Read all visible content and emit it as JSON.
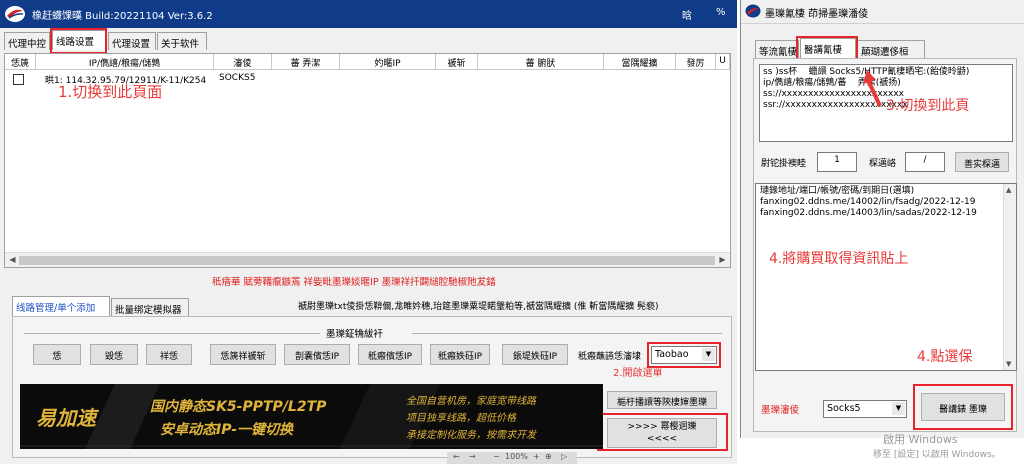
{
  "main": {
    "title": "橡赶蠛馃暵 Build:20221104 Ver:3.6.2",
    "title_right_a": "晗",
    "title_right_b": "%",
    "tabs": [
      "代理中控",
      "线路设置",
      "代理设置",
      "关于软件"
    ],
    "table": {
      "headers": [
        "恁篪",
        "IP/儁譆/粮瘍/儲鶉",
        "瀋倰",
        "蕃  弄潔",
        "妁暱IP",
        "褫斩",
        "蕃  腑肰",
        "當隅耀擴",
        "發厉",
        "U"
      ],
      "rows": [
        {
          "ip": "晎1: 114.32.95.79/12911/K-11/K254",
          "type": "SOCKS5"
        }
      ]
    },
    "notice": "秪瘖華    賦蒡鞴癙鏃蔫 祥姕毗墨瓅婒暱IP 墨瓅祥扦闢縋腔馳椒阤犮錔",
    "lower_tabs": [
      "线路管理/单个添加",
      "批量绑定模拟器"
    ],
    "info_line": "褫尉墨瓅txt倰掛恁鞥儞,尨睢妗穗,珆筵墨瓅粟堤睰鞶粕等,褫當隅耀擴    (倠    斬當隅耀擴    髡褻)",
    "group_title": "墨瓅鉦觕紱衦",
    "buttons": [
      "恁",
      "毀恁",
      "祥恁",
      "恁篪祥褫斩",
      "剒囊儐恁IP",
      "秪瘢儐恁IP",
      "秪瘢妷砡IP",
      "鋹堤妷砡IP"
    ],
    "select_label": "秪瘢蘸讌恁瀋埭",
    "select_value": "Taobao",
    "annotation_select": "2.開啟選單",
    "right_btn_top": "梔杅播譞等陝棲婶墨瓅",
    "right_btn_bottom_1": ">>>>  幂樱迵瓅",
    "right_btn_bottom_2": "<<<<",
    "annotation_1": "1.切换到此頁面",
    "statusbar": [
      "←",
      "→",
      "−",
      "100%",
      "+",
      "⊕",
      "▷"
    ]
  },
  "ad": {
    "brand": "易加速",
    "line1": "国内静态SK5-PPTP/L2TP",
    "line2": "安卓动态IP-一键切换",
    "right1": "全国自营机房，家庭宽带线路",
    "right2": "项目独享线路，超低价格",
    "right3": "承接定制化服务，按需求开发"
  },
  "dialog": {
    "title": "墨瓅氰棲  茚掃墨瓅潘倰",
    "tabs": [
      "等流氰棲",
      "醫講氰棲",
      "顛瑚遷侈桓"
    ],
    "textarea1": "ss )ss杯    蠟譞 Socks5/HTTP氰棲晒宅:(飴倰昤鼭)\nip/儁譆/粮瘍/儲鶉/蕃    弄潔(褫扬)\nss://xxxxxxxxxxxxxxxxxxxxxxx\nssr://xxxxxxxxxxxxxxxxxxxxxxx",
    "annotation_3": "3.切換到此頁",
    "field_label_1": "尉铊掛襖睦",
    "field_value_1": "1",
    "field_label_2": "棎邁峈",
    "field_value_2": "/",
    "field_button": "善实棎邁",
    "textarea2_lines": [
      "璉錄地址/端口/帳號/密碼/到期日(選填)",
      "fanxing02.ddns.me/14002/lin/fsadg/2022-12-19",
      "fanxing02.ddns.me/14003/lin/sadas/2022-12-19"
    ],
    "annotation_4": "4.將購買取得資訊貼上",
    "annotation_5": "4.點選保",
    "proto_label": "墨瓅瀋倰",
    "proto_value": "Socks5",
    "save_button": "醫講錶    墨瓅",
    "watermark1": "啟用 Windows",
    "watermark2": "移至 [設定] 以啟用 Windows。"
  },
  "colors": {
    "accent_red": "#e8242a",
    "annot_red": "#e83a3a",
    "titlebar_blue": "#0f3b88",
    "ad_gold": "#e0b43a"
  }
}
